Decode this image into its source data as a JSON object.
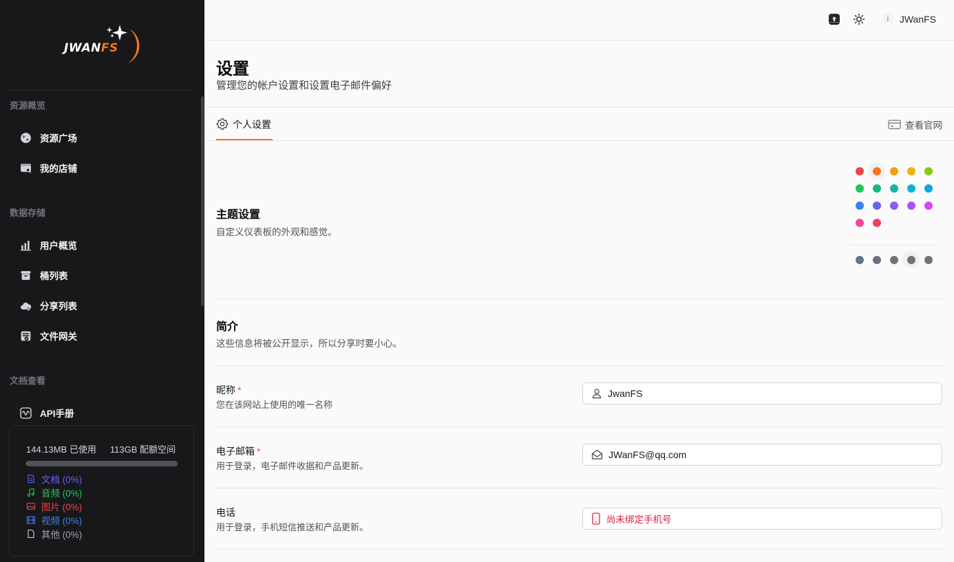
{
  "brand": {
    "logo_main": "JWAN",
    "logo_accent": "FS",
    "accent_color": "#f97316"
  },
  "sidebar": {
    "sections": [
      {
        "title": "资源概览",
        "items": [
          {
            "label": "资源广场",
            "icon": "globe-icon"
          },
          {
            "label": "我的店铺",
            "icon": "store-icon"
          }
        ]
      },
      {
        "title": "数据存储",
        "items": [
          {
            "label": "用户概览",
            "icon": "bar-chart-icon"
          },
          {
            "label": "桶列表",
            "icon": "archive-icon"
          },
          {
            "label": "分享列表",
            "icon": "cloud-icon"
          },
          {
            "label": "文件网关",
            "icon": "gateway-icon"
          }
        ]
      },
      {
        "title": "文档查看",
        "items": [
          {
            "label": "API手册",
            "icon": "api-wave-icon"
          }
        ]
      }
    ],
    "storage": {
      "used": "144.13MB 已使用",
      "quota": "113GB 配额空间",
      "used_fraction": 0.0013,
      "legend": [
        {
          "label": "文档 (0%)",
          "icon": "document-icon",
          "color": "#6366f1"
        },
        {
          "label": "音频 (0%)",
          "icon": "music-icon",
          "color": "#22c55e"
        },
        {
          "label": "图片 (0%)",
          "icon": "image-icon",
          "color": "#ef4444"
        },
        {
          "label": "视频 (0%)",
          "icon": "film-icon",
          "color": "#3b82f6"
        },
        {
          "label": "其他 (0%)",
          "icon": "file-icon",
          "color": "#a1a1aa"
        }
      ]
    }
  },
  "header": {
    "username": "JWanFS",
    "avatar_initial": "i"
  },
  "page": {
    "title": "设置",
    "subtitle": "管理您的帐户设置和设置电子邮件偏好",
    "tab_label": "个人设置",
    "site_link": "查看官网"
  },
  "theme": {
    "title": "主题设置",
    "desc": "自定义仪表板的外观和感觉。",
    "accent_colors": [
      "#ef4444",
      "#f97316",
      "#f59e0b",
      "#eab308",
      "#84cc16",
      "#22c55e",
      "#10b981",
      "#14b8a6",
      "#06b6d4",
      "#0ea5e9",
      "#3b82f6",
      "#6366f1",
      "#8b5cf6",
      "#a855f7",
      "#d946ef",
      "#ec4899",
      "#f43f5e"
    ],
    "selected_accent": 1,
    "neutral_colors": [
      "#64748b",
      "#6b7280",
      "#71717a",
      "#737373",
      "#78716c"
    ],
    "selected_neutral": 3
  },
  "profile": {
    "title": "简介",
    "desc": "这些信息将被公开显示，所以分享时要小心。",
    "nickname": {
      "label": "昵称",
      "required": "*",
      "desc": "您在该网站上使用的唯一名称",
      "value": "JwanFS"
    },
    "email": {
      "label": "电子邮箱",
      "required": "*",
      "desc": "用于登录，电子邮件收据和产品更新。",
      "value": "JWanFS@qq.com"
    },
    "phone": {
      "label": "电话",
      "desc": "用于登录，手机短信推送和产品更新。",
      "value": "尚未绑定手机号"
    }
  }
}
